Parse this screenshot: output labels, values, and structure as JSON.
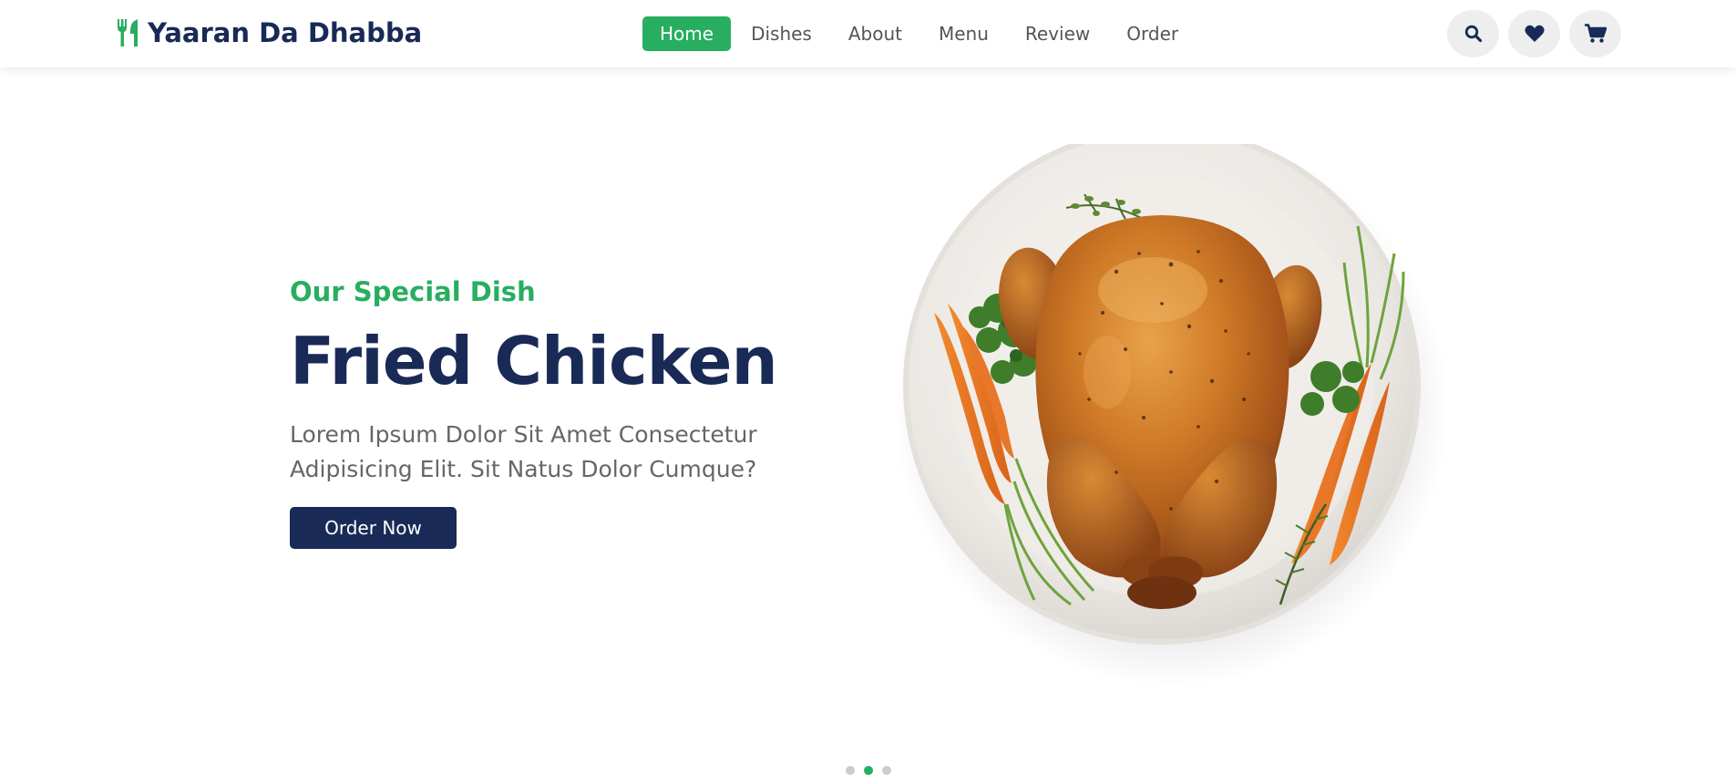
{
  "brand": {
    "name": "Yaaran Da Dhabba",
    "icon": "utensils-icon"
  },
  "nav": {
    "items": [
      {
        "label": "Home",
        "active": true
      },
      {
        "label": "Dishes",
        "active": false
      },
      {
        "label": "About",
        "active": false
      },
      {
        "label": "Menu",
        "active": false
      },
      {
        "label": "Review",
        "active": false
      },
      {
        "label": "Order",
        "active": false
      }
    ]
  },
  "header_icons": [
    "search-icon",
    "heart-icon",
    "cart-icon"
  ],
  "hero": {
    "subtitle": "Our Special Dish",
    "title": "Fried Chicken",
    "description": "Lorem Ipsum Dolor Sit Amet Consectetur Adipisicing Elit. Sit Natus Dolor Cumque?",
    "button_label": "Order Now",
    "image": "roast-chicken-plate"
  },
  "slider": {
    "total": 3,
    "active_index": 2
  },
  "colors": {
    "accent_green": "#27ae60",
    "navy": "#192a56",
    "text_gray": "#666666",
    "icon_bg": "#eeeeee"
  }
}
